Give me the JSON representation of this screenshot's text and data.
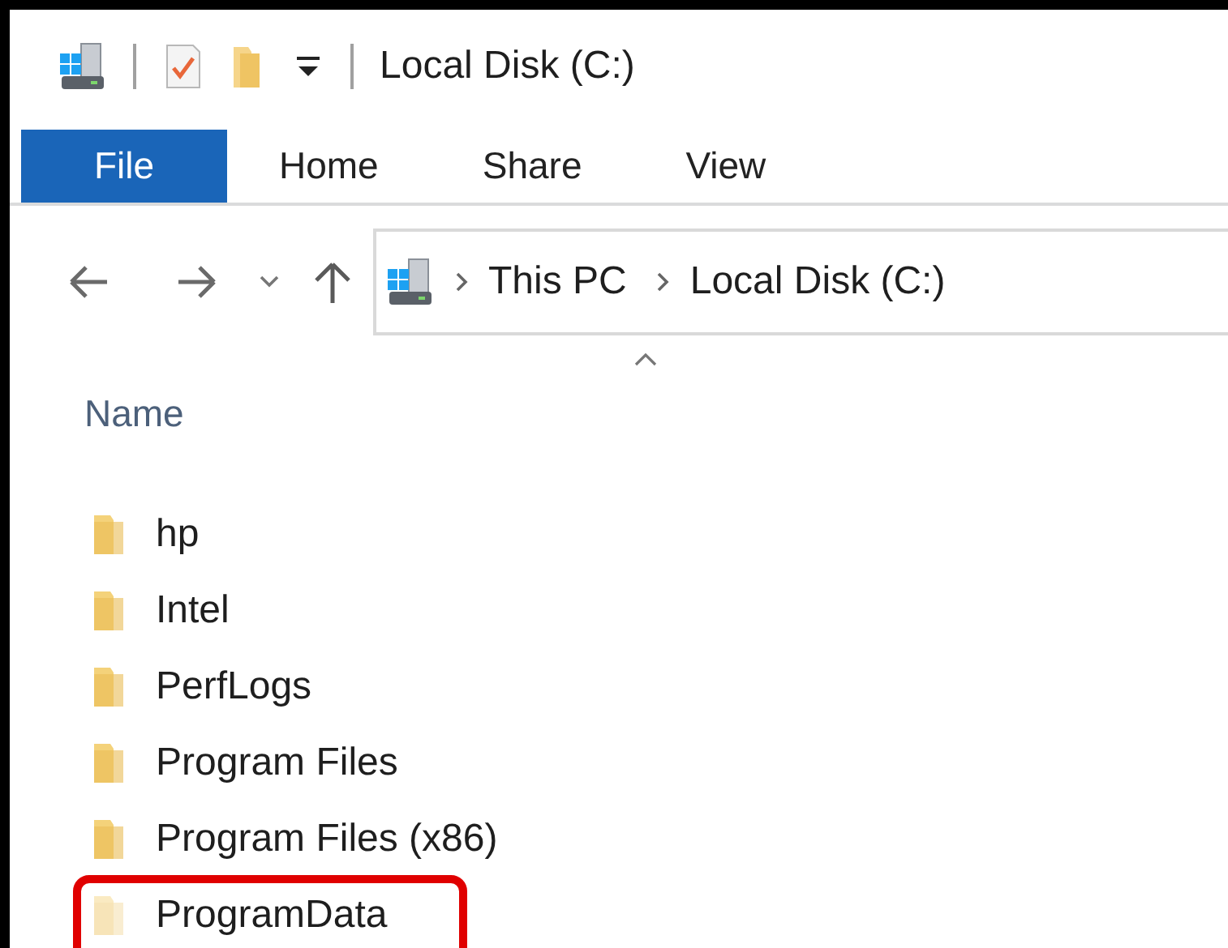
{
  "window": {
    "title": "Local Disk (C:)"
  },
  "tabs": [
    {
      "label": "File",
      "kind": "file_menu"
    },
    {
      "label": "Home",
      "kind": "tab"
    },
    {
      "label": "Share",
      "kind": "tab"
    },
    {
      "label": "View",
      "kind": "tab"
    }
  ],
  "address_bar": {
    "crumbs": [
      "This PC",
      "Local Disk (C:)"
    ]
  },
  "column": {
    "label": "Name",
    "sort_ascending": true
  },
  "files": [
    {
      "name": "hp",
      "hidden": false,
      "highlighted": false
    },
    {
      "name": "Intel",
      "hidden": false,
      "highlighted": false
    },
    {
      "name": "PerfLogs",
      "hidden": false,
      "highlighted": false
    },
    {
      "name": "Program Files",
      "hidden": false,
      "highlighted": false
    },
    {
      "name": "Program Files (x86)",
      "hidden": false,
      "highlighted": false
    },
    {
      "name": "ProgramData",
      "hidden": true,
      "highlighted": true
    }
  ]
}
